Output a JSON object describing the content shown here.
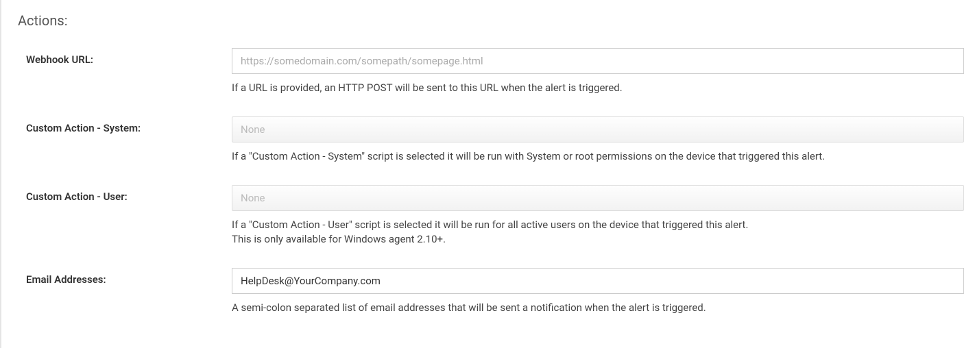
{
  "section": {
    "title": "Actions:"
  },
  "webhook": {
    "label": "Webhook URL:",
    "placeholder": "https://somedomain.com/somepath/somepage.html",
    "value": "",
    "help": "If a URL is provided, an HTTP POST will be sent to this URL when the alert is triggered."
  },
  "customActionSystem": {
    "label": "Custom Action - System:",
    "selected": "None",
    "help": "If a \"Custom Action - System\" script is selected it will be run with System or root permissions on the device that triggered this alert."
  },
  "customActionUser": {
    "label": "Custom Action - User:",
    "selected": "None",
    "help_line1": "If a \"Custom Action - User\" script is selected it will be run for all active users on the device that triggered this alert.",
    "help_line2": "This is only available for Windows agent 2.10+."
  },
  "emailAddresses": {
    "label": "Email Addresses:",
    "value": "HelpDesk@YourCompany.com",
    "help": "A semi-colon separated list of email addresses that will be sent a notification when the alert is triggered."
  }
}
